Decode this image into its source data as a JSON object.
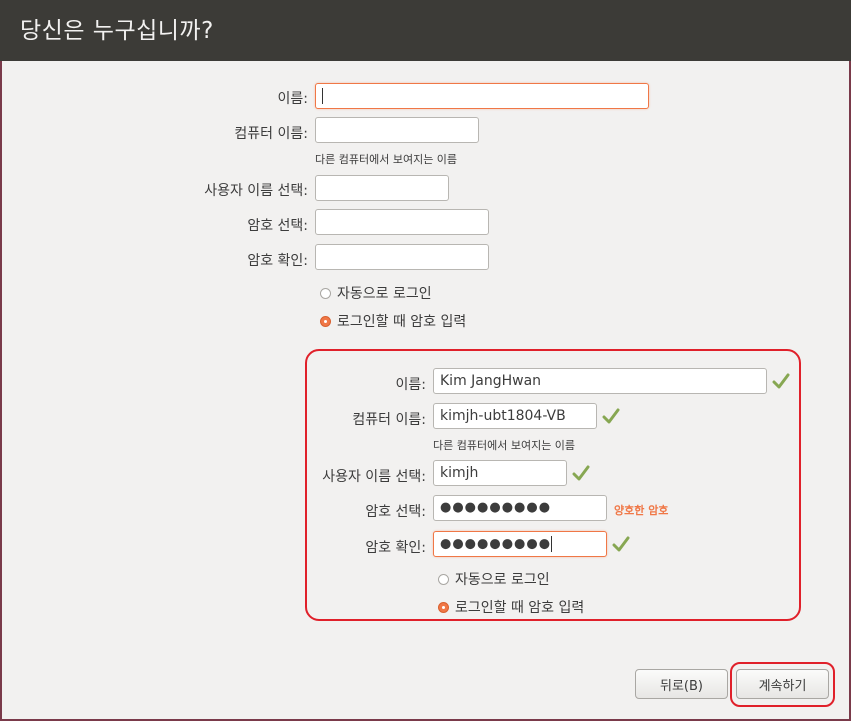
{
  "window": {
    "title": "당신은 누구십니까?"
  },
  "form_top": {
    "name_label": "이름:",
    "name_value": "",
    "computer_label": "컴퓨터 이름:",
    "computer_value": "",
    "computer_hint": "다른 컴퓨터에서 보여지는 이름",
    "username_label": "사용자 이름 선택:",
    "username_value": "",
    "password_label": "암호 선택:",
    "password_value": "",
    "confirm_label": "암호 확인:",
    "confirm_value": "",
    "auto_login_label": "자동으로 로그인",
    "require_password_label": "로그인할 때 암호 입력",
    "selected_option": "require_password"
  },
  "form_filled": {
    "name_label": "이름:",
    "name_value": "Kim JangHwan",
    "computer_label": "컴퓨터 이름:",
    "computer_value": "kimjh-ubt1804-VB",
    "computer_hint": "다른 컴퓨터에서 보여지는 이름",
    "username_label": "사용자 이름 선택:",
    "username_value": "kimjh",
    "password_label": "암호 선택:",
    "password_value": "●●●●●●●●●",
    "password_strength": "양호한 암호",
    "confirm_label": "암호 확인:",
    "confirm_value": "●●●●●●●●●",
    "auto_login_label": "자동으로 로그인",
    "require_password_label": "로그인할 때 암호 입력",
    "selected_option": "require_password"
  },
  "buttons": {
    "back_label": "뒤로(B)",
    "continue_label": "계속하기"
  },
  "colors": {
    "accent": "#f07746",
    "titlebar": "#3c3b37",
    "annotation_red": "#e0202a",
    "check_green": "#87a752"
  },
  "icons": {
    "valid": "checkmark-icon"
  }
}
